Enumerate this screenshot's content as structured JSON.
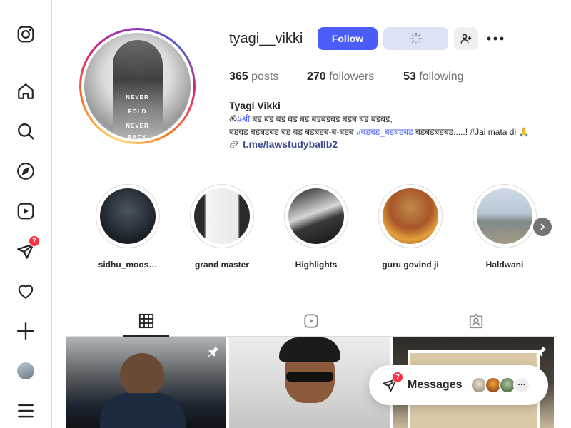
{
  "sidebar": {
    "items": [
      {
        "name": "instagram-logo-icon"
      },
      {
        "name": "home-icon"
      },
      {
        "name": "search-icon"
      },
      {
        "name": "explore-icon"
      },
      {
        "name": "reels-icon"
      },
      {
        "name": "messages-icon",
        "badge": "7"
      },
      {
        "name": "notifications-icon"
      },
      {
        "name": "create-icon"
      },
      {
        "name": "profile-avatar"
      },
      {
        "name": "menu-icon"
      }
    ]
  },
  "profile": {
    "username": "tyagi__vikki",
    "follow_label": "Follow",
    "stats": {
      "posts_count": "365",
      "posts_label": "posts",
      "followers_count": "270",
      "followers_label": "followers",
      "following_count": "53",
      "following_label": "following"
    },
    "full_name": "Tyagi Vikki",
    "bio": {
      "line1_prefix": "ॐ",
      "line1_tag": "#श्री",
      "line1_rest": " बड बड बड बड बड बडबडबड बडब बड बडबड,",
      "line2_prefix": "बडबड बडबडबड बड बड बडबडब-ब-बडब ",
      "line2_tag": "#बडबड_बडबडबड",
      "line2_rest": " बडबडबडबड.....! #Jai mata di 🙏",
      "link": "t.me/lawstudyballb2"
    }
  },
  "highlights": [
    {
      "label": "sidhu_moosewala",
      "display": "sidhu_moos…"
    },
    {
      "label": "grand master"
    },
    {
      "label": "Highlights"
    },
    {
      "label": "guru govind ji"
    },
    {
      "label": "Haldwani"
    }
  ],
  "tabs": [
    {
      "name": "posts-tab",
      "active": true
    },
    {
      "name": "reels-tab",
      "active": false
    },
    {
      "name": "tagged-tab",
      "active": false
    }
  ],
  "messages": {
    "label": "Messages",
    "badge": "7",
    "more": "···"
  },
  "colors": {
    "accent": "#4a5df9",
    "badge": "#ff3040",
    "border": "#dbdbdb",
    "text": "#262626",
    "muted": "#737373"
  }
}
